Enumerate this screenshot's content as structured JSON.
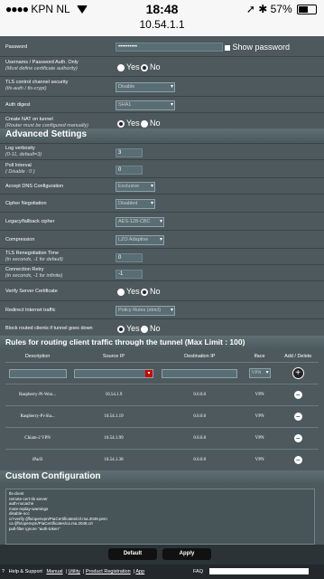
{
  "status": {
    "carrier": "KPN NL",
    "time": "18:48",
    "url": "10.54.1.1",
    "battery": "57%",
    "battery_level": 0.57
  },
  "auth": {
    "password_label": "Password",
    "password_value": "••••••••••",
    "show_password": "Show password",
    "userpass_label": "Usernams / Password Auth. Only",
    "userpass_note": "(Must define certificate authority)",
    "tls_label": "TLS control channel security",
    "tls_note": "(tls-auth / tls-crypt)",
    "tls_value": "Disable",
    "digest_label": "Auth digest",
    "digest_value": "SHA1",
    "nat_label": "Create NAT on tunnel",
    "nat_note": "(Router must be configured manually)",
    "yes": "Yes",
    "no": "No"
  },
  "advanced": {
    "title": "Advanced Settings",
    "verbosity_label": "Log verbosity",
    "verbosity_note": "(0-11, default=3)",
    "verbosity_value": "3",
    "poll_label": "Poll Interval",
    "poll_note": "( Disable : 0 )",
    "poll_value": "0",
    "dns_label": "Accept DNS Configuration",
    "dns_value": "Exclusive",
    "cipher_label": "Cipher Negotiation",
    "cipher_value": "Disabled",
    "legacy_label": "Legacy/fallback cipher",
    "legacy_value": "AES-128-CBC",
    "compression_label": "Compression",
    "compression_value": "LZO Adaptive",
    "reneg_label": "TLS Renegotiation Time",
    "reneg_note": "(in seconds, -1 for default)",
    "reneg_value": "0",
    "retry_label": "Connection Retry",
    "retry_note": "(in seconds, -1 for infinite)",
    "retry_value": "-1",
    "verify_label": "Verify Server Certificate",
    "redirect_label": "Redirect Internet traffic",
    "redirect_value": "Policy Rules (strict)",
    "block_label": "Block routed clients if tunnel goes down",
    "yes": "Yes",
    "no": "No"
  },
  "rules": {
    "title": "Rules for routing client traffic through the tunnel (Max Limit : 100)",
    "headers": [
      "Description",
      "Source IP",
      "Destination IP",
      "Iface",
      "Add / Delete"
    ],
    "new_iface": "VPN",
    "rows": [
      {
        "desc": "Raspberry-Pi-Woo...",
        "src": "10.54.1.9",
        "dst": "0.0.0.0",
        "iface": "VPN"
      },
      {
        "desc": "Raspberry-Pi-Sla...",
        "src": "10.54.1.19",
        "dst": "0.0.0.0",
        "iface": "VPN"
      },
      {
        "desc": "Chiam-2 VPN",
        "src": "10.54.1.99",
        "dst": "0.0.0.0",
        "iface": "VPN"
      },
      {
        "desc": "iPad3",
        "src": "10.54.1.38",
        "dst": "0.0.0.0",
        "iface": "VPN"
      }
    ]
  },
  "custom": {
    "title": "Custom Configuration",
    "text": "tls-client\nremote-cert-tls server\nauth-nocache\nmute-replay-warnings\ndisable-occ\ncrl-verify /jffs/openvpn/PiaCertificates/crl.rsa.2048.pem\nca /jffs/openvpn/PiaCertificates/ca.rsa.2048.crt\npull-filter ignore \"auth-token\""
  },
  "buttons": {
    "default": "Default",
    "apply": "Apply"
  },
  "footer": {
    "help": "Help & Support",
    "manual": "Manual",
    "utility": "Utility",
    "registration": "Product Registration",
    "app": "App",
    "faq": "FAQ"
  }
}
